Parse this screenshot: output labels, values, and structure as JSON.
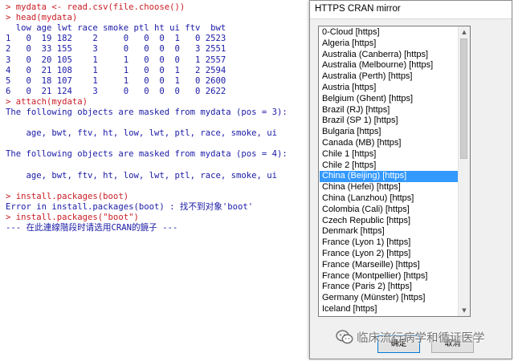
{
  "console": {
    "lines": [
      {
        "text": "> mydata <- read.csv(file.choose())",
        "kind": "input"
      },
      {
        "text": "> head(mydata)",
        "kind": "input"
      },
      {
        "text": "  low age lwt race smoke ptl ht ui ftv  bwt",
        "kind": "output"
      },
      {
        "text": "1   0  19 182    2     0   0  0  1   0 2523",
        "kind": "output"
      },
      {
        "text": "2   0  33 155    3     0   0  0  0   3 2551",
        "kind": "output"
      },
      {
        "text": "3   0  20 105    1     1   0  0  0   1 2557",
        "kind": "output"
      },
      {
        "text": "4   0  21 108    1     1   0  0  1   2 2594",
        "kind": "output"
      },
      {
        "text": "5   0  18 107    1     1   0  0  1   0 2600",
        "kind": "output"
      },
      {
        "text": "6   0  21 124    3     0   0  0  0   0 2622",
        "kind": "output"
      },
      {
        "text": "> attach(mydata)",
        "kind": "input"
      },
      {
        "text": "The following objects are masked from mydata (pos = 3):",
        "kind": "output"
      },
      {
        "text": "",
        "kind": "output"
      },
      {
        "text": "    age, bwt, ftv, ht, low, lwt, ptl, race, smoke, ui",
        "kind": "output"
      },
      {
        "text": "",
        "kind": "output"
      },
      {
        "text": "The following objects are masked from mydata (pos = 4):",
        "kind": "output"
      },
      {
        "text": "",
        "kind": "output"
      },
      {
        "text": "    age, bwt, ftv, ht, low, lwt, ptl, race, smoke, ui",
        "kind": "output"
      },
      {
        "text": "",
        "kind": "output"
      },
      {
        "text": "> install.packages(boot)",
        "kind": "input"
      },
      {
        "text": "Error in install.packages(boot) : 找不到对象'boot'",
        "kind": "output"
      },
      {
        "text": "> install.packages(\"boot\")",
        "kind": "input"
      },
      {
        "text": "--- 在此連線階段时请选用CRAN的鏡子 ---",
        "kind": "output"
      }
    ]
  },
  "dialog": {
    "title": "HTTPS CRAN mirror",
    "mirrors": [
      "0-Cloud [https]",
      "Algeria [https]",
      "Australia (Canberra) [https]",
      "Australia (Melbourne) [https]",
      "Australia (Perth) [https]",
      "Austria [https]",
      "Belgium (Ghent) [https]",
      "Brazil (RJ) [https]",
      "Brazil (SP 1) [https]",
      "Bulgaria [https]",
      "Canada (MB) [https]",
      "Chile 1 [https]",
      "Chile 2 [https]",
      "China (Beijing) [https]",
      "China (Hefei) [https]",
      "China (Lanzhou) [https]",
      "Colombia (Cali) [https]",
      "Czech Republic [https]",
      "Denmark [https]",
      "France (Lyon 1) [https]",
      "France (Lyon 2) [https]",
      "France (Marseille) [https]",
      "France (Montpellier) [https]",
      "France (Paris 2) [https]",
      "Germany (Münster) [https]",
      "Iceland [https]"
    ],
    "selected": "China (Beijing) [https]",
    "ok_label": "确定",
    "cancel_label": "取消"
  },
  "watermark": {
    "text": "临床流行病学和循证医学",
    "icon": "wechat-icon"
  },
  "colors": {
    "input": "#c81d24",
    "output": "#1a1aa6",
    "selection": "#3399ff"
  }
}
